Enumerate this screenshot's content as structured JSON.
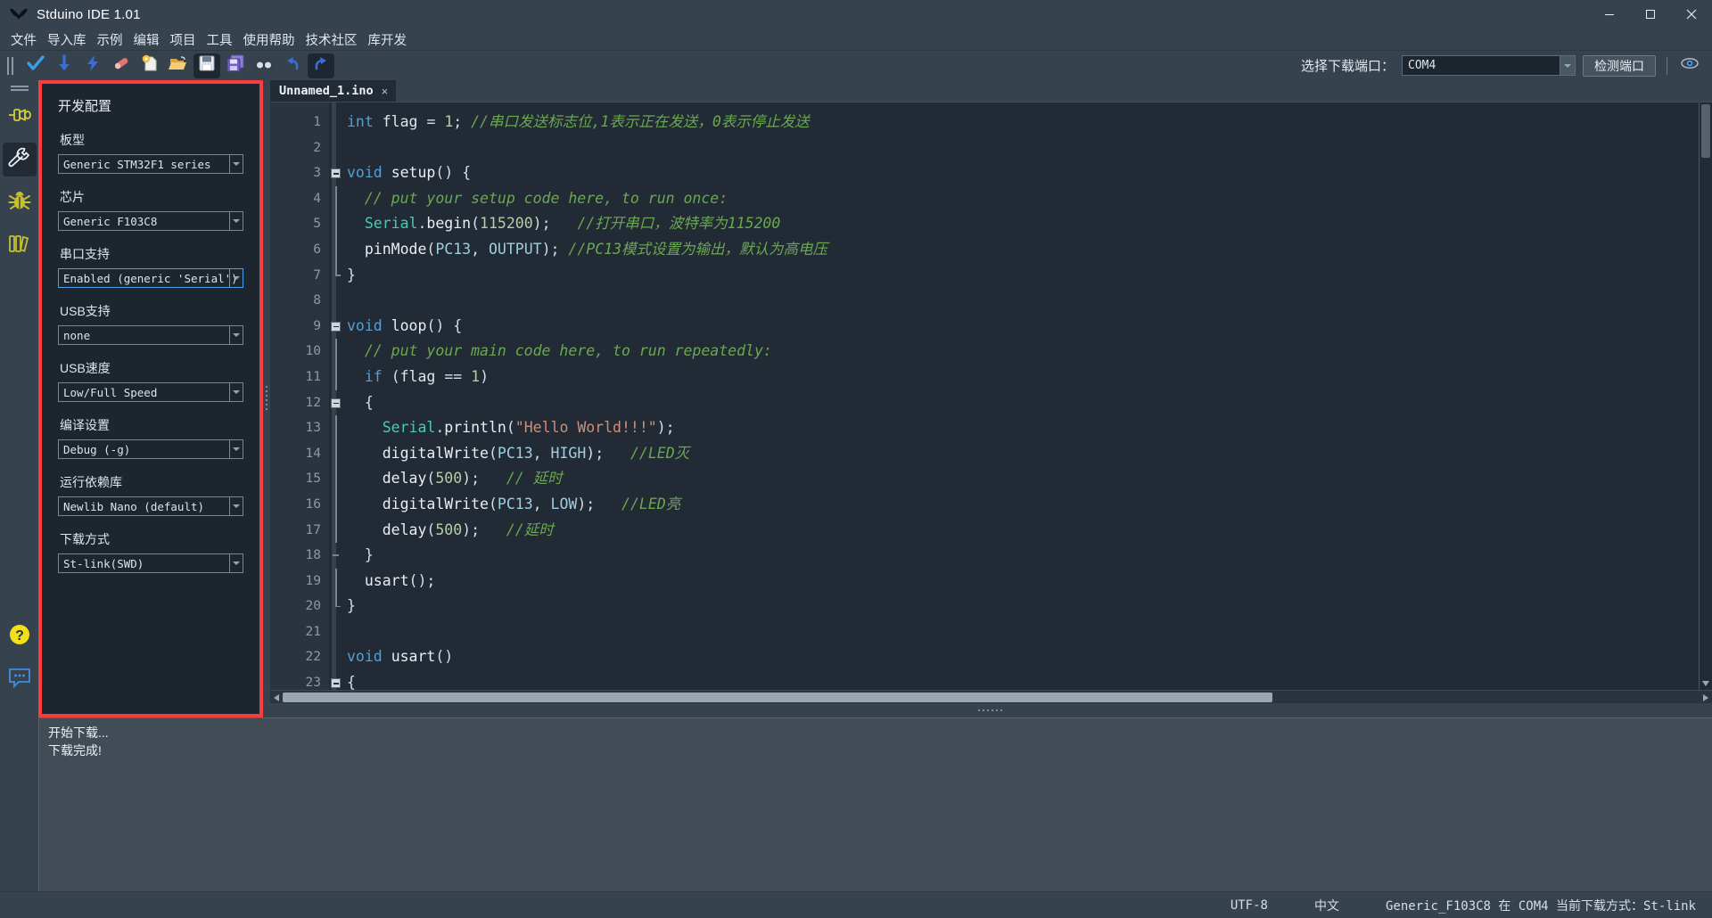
{
  "window": {
    "title": "Stduino IDE 1.01",
    "minimize": "minimize-icon",
    "maximize": "maximize-icon",
    "close": "close-icon"
  },
  "menubar": {
    "items": [
      {
        "label": "文件"
      },
      {
        "label": "导入库"
      },
      {
        "label": "示例"
      },
      {
        "label": "编辑"
      },
      {
        "label": "项目"
      },
      {
        "label": "工具"
      },
      {
        "label": "使用帮助"
      },
      {
        "label": "技术社区"
      },
      {
        "label": "库开发"
      }
    ]
  },
  "toolbar": {
    "buttons": [
      {
        "name": "verify-icon"
      },
      {
        "name": "download-icon"
      },
      {
        "name": "flash-icon"
      },
      {
        "name": "eraser-icon"
      },
      {
        "name": "new-file-icon"
      },
      {
        "name": "open-folder-icon"
      },
      {
        "name": "save-icon"
      },
      {
        "name": "save-all-icon"
      },
      {
        "name": "find-icon"
      },
      {
        "name": "undo-icon"
      },
      {
        "name": "redo-icon"
      }
    ],
    "port_label": "选择下载端口：",
    "port_value": "COM4",
    "detect_button": "检测端口",
    "serial_monitor_icon": "eye-icon"
  },
  "activitybar": {
    "items": [
      {
        "name": "pin-icon"
      },
      {
        "name": "wrench-icon",
        "active": true
      },
      {
        "name": "bug-icon"
      },
      {
        "name": "library-icon"
      }
    ],
    "bottom": [
      {
        "name": "help-icon"
      },
      {
        "name": "feedback-icon"
      }
    ]
  },
  "sidepanel": {
    "title": "开发配置",
    "highlighted": true,
    "highlight_color": "#fc3b3b",
    "fields": [
      {
        "label": "板型",
        "value": "Generic STM32F1 series",
        "focused": false
      },
      {
        "label": "芯片",
        "value": "Generic F103C8",
        "focused": false
      },
      {
        "label": "串口支持",
        "value": "Enabled (generic 'Serial')",
        "focused": true
      },
      {
        "label": "USB支持",
        "value": "none",
        "focused": false
      },
      {
        "label": "USB速度",
        "value": "Low/Full Speed",
        "focused": false
      },
      {
        "label": "编译设置",
        "value": "Debug (-g)",
        "focused": false
      },
      {
        "label": "运行依赖库",
        "value": "Newlib Nano (default)",
        "focused": false
      },
      {
        "label": "下载方式",
        "value": "St-link(SWD)",
        "focused": false
      }
    ]
  },
  "editor": {
    "tab": {
      "name": "Unnamed_1.ino",
      "close": "×"
    },
    "line_numbers": [
      1,
      2,
      3,
      4,
      5,
      6,
      7,
      8,
      9,
      10,
      11,
      12,
      13,
      14,
      15,
      16,
      17,
      18,
      19,
      20,
      21,
      22,
      23
    ],
    "lines": [
      {
        "n": 1,
        "text": "int flag = 1; //串口发送标志位,1表示正在发送，0表示停止发送"
      },
      {
        "n": 2,
        "text": ""
      },
      {
        "n": 3,
        "text": "void setup() {"
      },
      {
        "n": 4,
        "text": "  // put your setup code here, to run once:"
      },
      {
        "n": 5,
        "text": "  Serial.begin(115200);   //打开串口，波特率为115200"
      },
      {
        "n": 6,
        "text": "  pinMode(PC13, OUTPUT); //PC13模式设置为输出，默认为高电压"
      },
      {
        "n": 7,
        "text": "}"
      },
      {
        "n": 8,
        "text": ""
      },
      {
        "n": 9,
        "text": "void loop() {"
      },
      {
        "n": 10,
        "text": "  // put your main code here, to run repeatedly:"
      },
      {
        "n": 11,
        "text": "  if (flag == 1)"
      },
      {
        "n": 12,
        "text": "  {"
      },
      {
        "n": 13,
        "text": "    Serial.println(\"Hello World!!!\");"
      },
      {
        "n": 14,
        "text": "    digitalWrite(PC13, HIGH);   //LED灭"
      },
      {
        "n": 15,
        "text": "    delay(500);   // 延时"
      },
      {
        "n": 16,
        "text": "    digitalWrite(PC13, LOW);   //LED亮"
      },
      {
        "n": 17,
        "text": "    delay(500);   //延时"
      },
      {
        "n": 18,
        "text": "  }"
      },
      {
        "n": 19,
        "text": "  usart();"
      },
      {
        "n": 20,
        "text": "}"
      },
      {
        "n": 21,
        "text": ""
      },
      {
        "n": 22,
        "text": "void usart()"
      },
      {
        "n": 23,
        "text": "{"
      }
    ]
  },
  "console": {
    "lines": [
      "开始下载...",
      "下载完成!"
    ]
  },
  "statusbar": {
    "encoding": "UTF-8",
    "language": "中文",
    "board_info": "Generic_F103C8 在 COM4 当前下载方式：St-link"
  }
}
